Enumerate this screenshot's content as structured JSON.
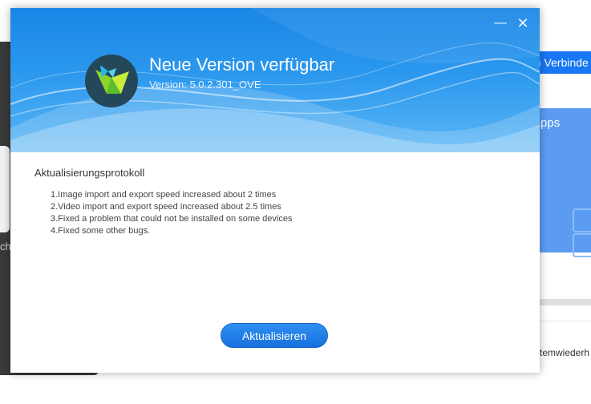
{
  "background_app": {
    "connect_button_label": "m Verbinde",
    "apps_label": "Apps",
    "left_text": "ch",
    "bottom_text": "temwiederh"
  },
  "dialog": {
    "title": "Neue Version verfügbar",
    "version": "Version: 5.0.2.301_OVE",
    "minimize_glyph": "—",
    "close_glyph": "✕",
    "changelog_heading": "Aktualisierungsprotokoll",
    "changelog": [
      "1.Image import and export speed increased about 2 times",
      "2.Video import and export speed increased about 2.5 times",
      "3.Fixed a problem that could not be installed on some devices",
      "4.Fixed some other bugs."
    ],
    "update_button_label": "Aktualisieren"
  },
  "colors": {
    "header_blue": "#2b98ee",
    "button_blue": "#1877f2",
    "logo_dark": "#24485a",
    "logo_green": "#8bd42a"
  }
}
